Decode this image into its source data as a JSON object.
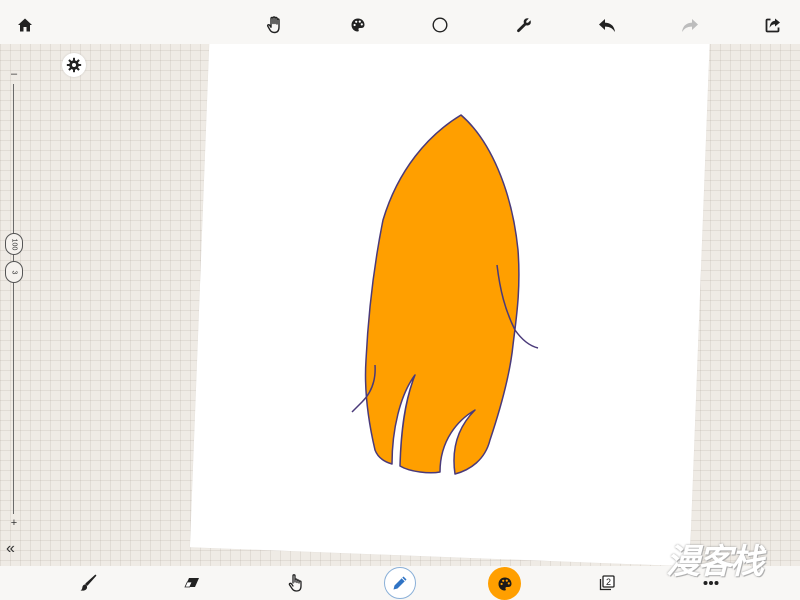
{
  "canvas": {
    "fill_color": "#ff9f00",
    "stroke_color": "#4a3a7a"
  },
  "top_toolbar": {
    "icons": [
      "home-icon",
      "hand-icon",
      "palette-icon",
      "circle-icon",
      "wrench-icon",
      "undo-icon",
      "redo-icon",
      "share-icon"
    ]
  },
  "left_panel": {
    "settings_icon": "gear-icon",
    "slider_min_symbol": "–",
    "slider_max_symbol": "+",
    "brush_opacity": "100",
    "brush_size": "3",
    "collapse_symbol": "«"
  },
  "bottom_toolbar": {
    "icons": [
      "brush-icon",
      "eraser-icon",
      "pointer-hand-icon",
      "pencil-icon",
      "palette-icon",
      "layers-icon",
      "more-icon"
    ],
    "layers_count": "2",
    "active_color": "#ff9f00",
    "active_tool_ring": "#8ab0d8"
  },
  "watermark": {
    "text": "漫客栈"
  }
}
